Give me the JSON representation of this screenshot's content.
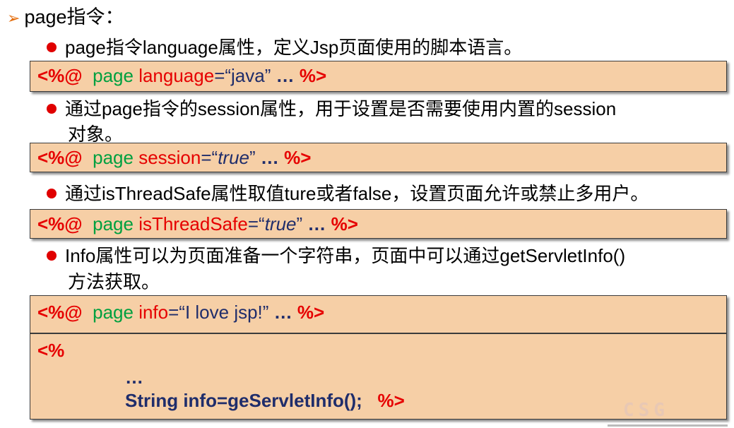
{
  "heading": {
    "arrow": "➢",
    "text": "page指令："
  },
  "items": [
    {
      "bullet": "page指令language属性，定义Jsp页面使用的脚本语言。",
      "code": {
        "open": "<%@",
        "page": "page",
        "attr": "language",
        "eq": "=",
        "value": "“java”",
        "dots": "…",
        "close": "%>"
      }
    },
    {
      "bullet_line1": "通过page指令的session属性，用于设置是否需要使用内置的session",
      "bullet_line2": "对象。",
      "code": {
        "open": "<%@",
        "page": "page",
        "attr": "session",
        "eq": "=",
        "q1": "“",
        "value": "true",
        "q2": "”",
        "dots": "…",
        "close": "%>"
      }
    },
    {
      "bullet": "通过isThreadSafe属性取值ture或者false，设置页面允许或禁止多用户。",
      "code": {
        "open": "<%@",
        "page": "page",
        "attr": "isThreadSafe",
        "eq": "=",
        "q1": "“",
        "value": "true",
        "q2": "”",
        "dots": "…",
        "close": "%>"
      }
    },
    {
      "bullet_line1": "Info属性可以为页面准备一个字符串，页面中可以通过getServletInfo()",
      "bullet_line2": "方法获取。",
      "code": {
        "open": "<%@",
        "page": "page",
        "attr": "info",
        "eq": "=",
        "value": "“I love jsp!”",
        "dots": "…",
        "close": "%>"
      },
      "scriptlet": {
        "open": "<%",
        "ellipsis": "…",
        "statement": "String info=geServletInfo();",
        "close": "%>"
      }
    }
  ],
  "watermark": "CSG",
  "colors": {
    "box_bg": "#f6cfa6",
    "red": "#e60000",
    "green": "#00a040",
    "navy": "#1f2d6b",
    "bullet": "#e00000",
    "arrow": "#e46c0a"
  }
}
